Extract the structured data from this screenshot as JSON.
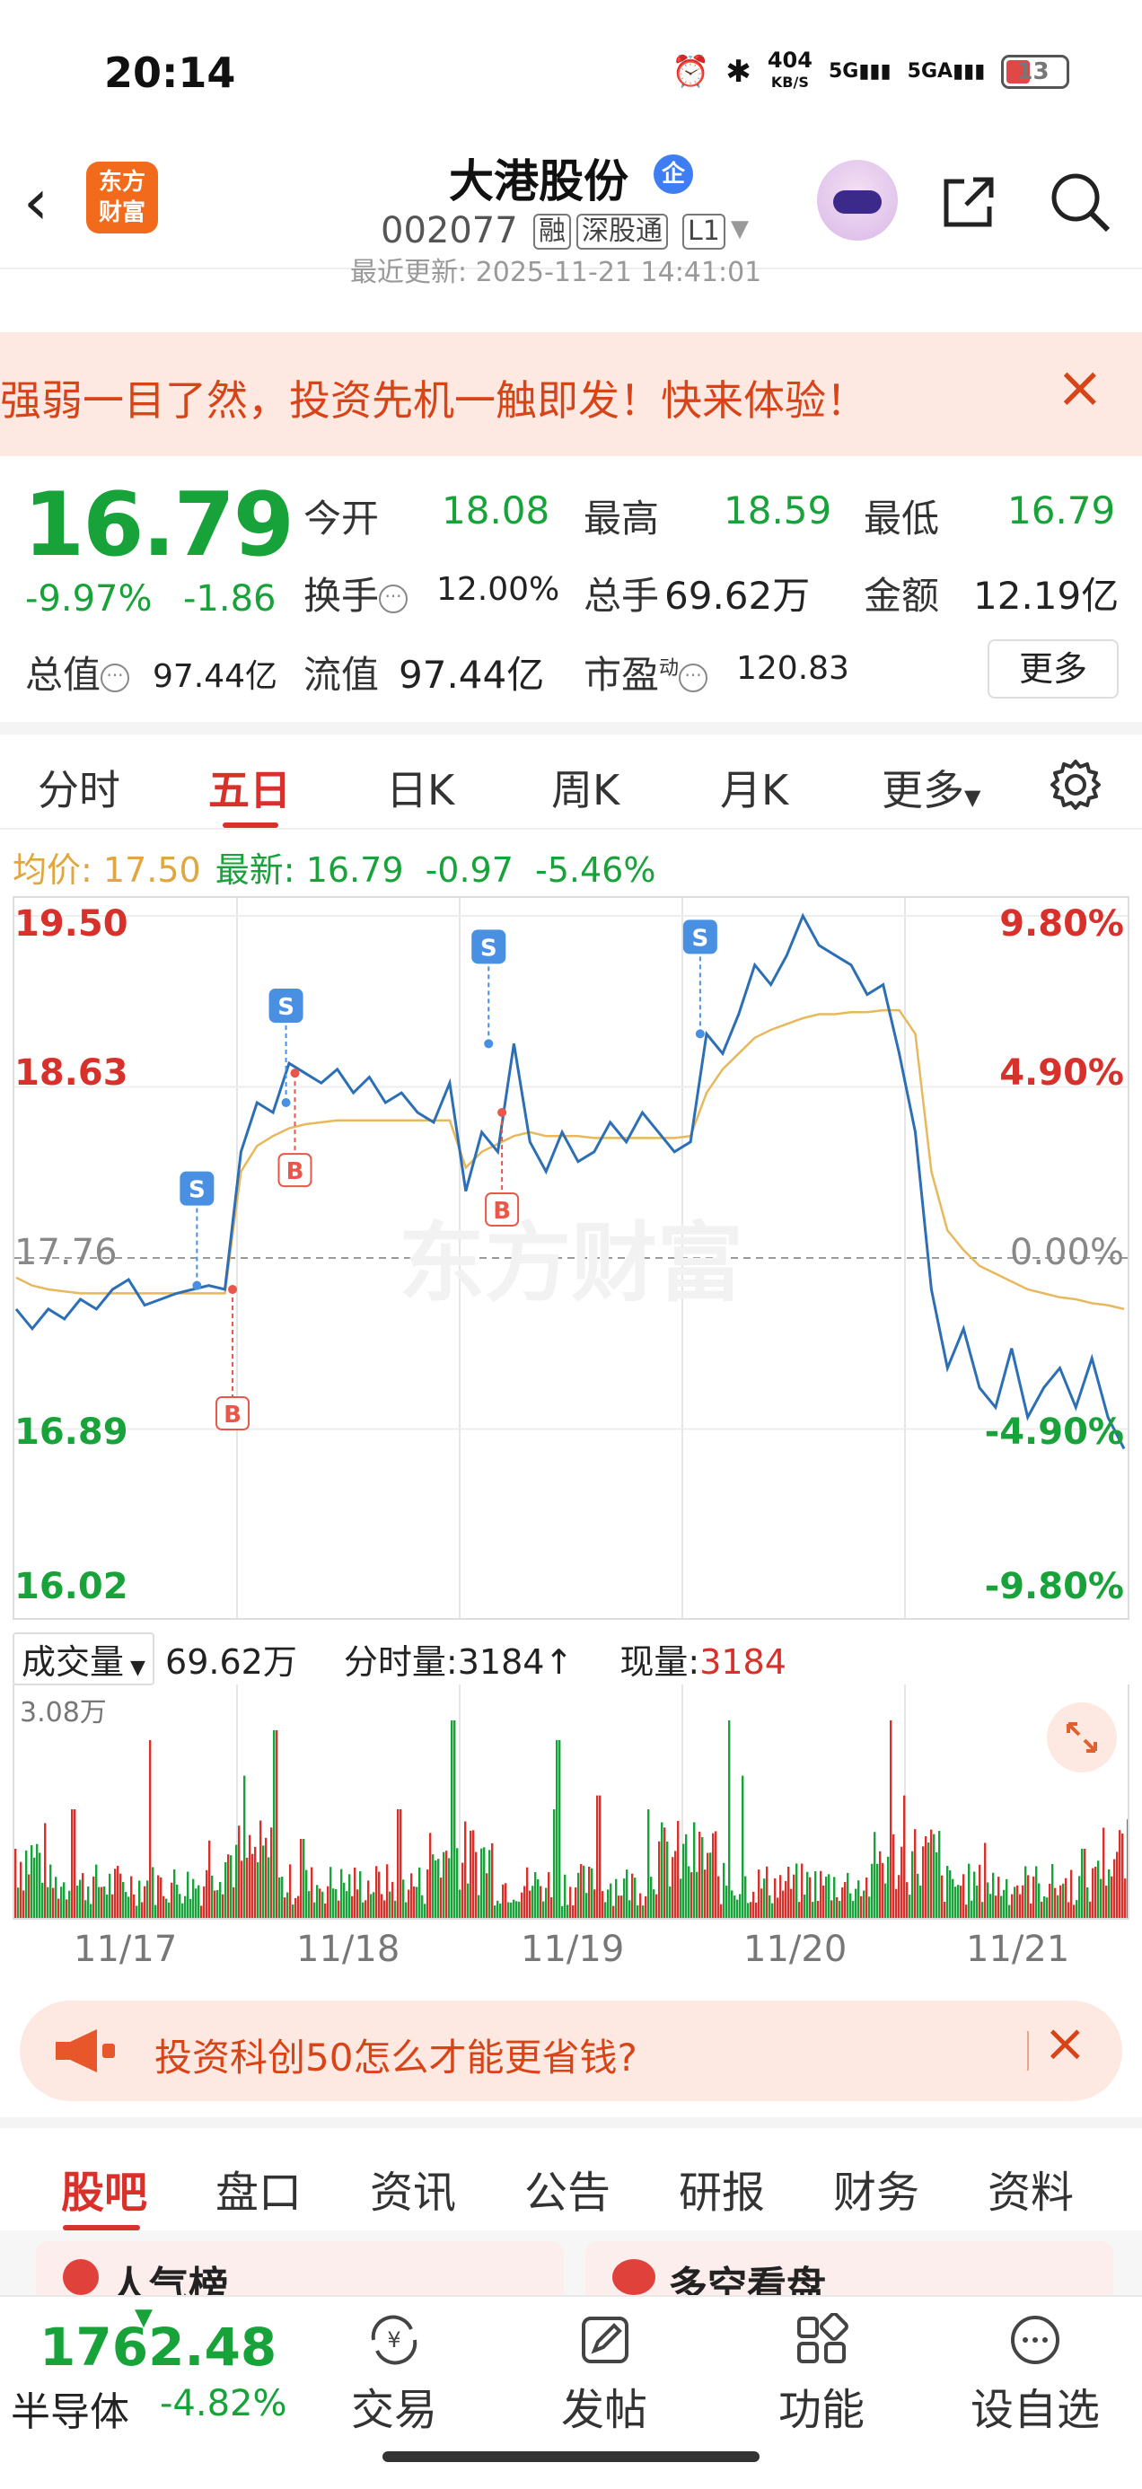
{
  "status_bar": {
    "time": "20:14",
    "net_speed_top": "404",
    "net_speed_unit": "KB/S",
    "signal_1": "5G",
    "signal_2": "5GA",
    "battery": "13"
  },
  "header": {
    "logo_line1": "东方",
    "logo_line2": "财富",
    "stock_name": "大港股份",
    "verified_badge": "企",
    "stock_code": "002077",
    "tags": [
      "融",
      "深股通",
      "L1"
    ],
    "last_update": "最近更新: 2025-11-21 14:41:01"
  },
  "banner": {
    "text": "强弱一目了然，投资先机一触即发！快来体验！"
  },
  "quote": {
    "price": "16.79",
    "pct_change": "-9.97%",
    "abs_change": "-1.86",
    "open_label": "今开",
    "open_value": "18.08",
    "high_label": "最高",
    "high_value": "18.59",
    "low_label": "最低",
    "low_value": "16.79",
    "turnover_label": "换手",
    "turnover_value": "12.00%",
    "volume_label": "总手",
    "volume_value": "69.62万",
    "amount_label": "金额",
    "amount_value": "12.19亿",
    "mcap_label": "总值",
    "mcap_value": "97.44亿",
    "float_label": "流值",
    "float_value": "97.44亿",
    "pe_label": "市盈",
    "pe_sup": "动",
    "pe_value": "120.83",
    "more_button": "更多"
  },
  "chart_tabs": [
    "分时",
    "五日",
    "日K",
    "周K",
    "月K",
    "更多"
  ],
  "active_chart_tab": "五日",
  "metrics": {
    "avg_label": "均价:",
    "avg_value": "17.50",
    "latest_label": "最新:",
    "latest_value": "16.79",
    "latest_change": "-0.97",
    "latest_pct": "-5.46%"
  },
  "chart_data": {
    "type": "line",
    "title": "",
    "x": [
      "11/17",
      "11/18",
      "11/19",
      "11/20",
      "11/21"
    ],
    "y_left_ticks": [
      "19.50",
      "18.63",
      "17.76",
      "16.89",
      "16.02"
    ],
    "y_right_ticks": [
      "9.80%",
      "4.90%",
      "0.00%",
      "-4.90%",
      "-9.80%"
    ],
    "ylim": [
      16.02,
      19.5
    ],
    "reference_price": 17.76,
    "series": [
      {
        "name": "最新",
        "color": "#2d6fb5",
        "values": [
          17.5,
          17.4,
          17.5,
          17.45,
          17.55,
          17.5,
          17.6,
          17.65,
          17.52,
          17.55,
          17.58,
          17.6,
          17.62,
          17.6,
          18.3,
          18.55,
          18.5,
          18.75,
          18.7,
          18.65,
          18.72,
          18.6,
          18.68,
          18.55,
          18.6,
          18.5,
          18.45,
          18.65,
          18.1,
          18.4,
          18.3,
          18.85,
          18.35,
          18.2,
          18.4,
          18.25,
          18.3,
          18.45,
          18.35,
          18.5,
          18.4,
          18.3,
          18.35,
          18.9,
          18.8,
          19.0,
          19.25,
          19.15,
          19.3,
          19.5,
          19.35,
          19.3,
          19.25,
          19.1,
          19.15,
          18.8,
          18.4,
          17.6,
          17.2,
          17.4,
          17.1,
          17.0,
          17.3,
          16.95,
          17.1,
          17.2,
          17.0,
          17.25,
          16.95,
          16.79
        ]
      },
      {
        "name": "均价",
        "color": "#e8b85c",
        "values": [
          17.66,
          17.62,
          17.6,
          17.59,
          17.58,
          17.58,
          17.58,
          17.58,
          17.58,
          17.58,
          17.58,
          17.58,
          17.58,
          17.58,
          18.2,
          18.33,
          18.38,
          18.42,
          18.44,
          18.45,
          18.46,
          18.46,
          18.46,
          18.46,
          18.46,
          18.46,
          18.46,
          18.46,
          18.22,
          18.3,
          18.34,
          18.38,
          18.4,
          18.38,
          18.38,
          18.38,
          18.37,
          18.37,
          18.37,
          18.37,
          18.37,
          18.37,
          18.38,
          18.6,
          18.72,
          18.8,
          18.88,
          18.92,
          18.95,
          18.98,
          19.0,
          19.0,
          19.01,
          19.01,
          19.02,
          19.02,
          18.9,
          18.2,
          17.9,
          17.8,
          17.72,
          17.68,
          17.64,
          17.6,
          17.58,
          17.56,
          17.55,
          17.53,
          17.52,
          17.5
        ]
      }
    ],
    "markers": [
      {
        "day": "11/17",
        "type": "S",
        "price": 17.62
      },
      {
        "day": "11/17",
        "type": "B",
        "price": 17.6
      },
      {
        "day": "11/18",
        "type": "S",
        "price": 18.55
      },
      {
        "day": "11/18",
        "type": "B",
        "price": 18.7
      },
      {
        "day": "11/19",
        "type": "S",
        "price": 18.85
      },
      {
        "day": "11/19",
        "type": "B",
        "price": 18.5
      },
      {
        "day": "11/20",
        "type": "S",
        "price": 18.9
      }
    ],
    "watermark": "东方财富"
  },
  "volume": {
    "selector_label": "成交量",
    "total": "69.62万",
    "minute_label": "分时量:",
    "minute_value": "3184",
    "minute_arrow": "↑",
    "current_label": "现量:",
    "current_value": "3184",
    "max_label": "3.08万"
  },
  "dates": [
    "11/17",
    "11/18",
    "11/19",
    "11/20",
    "11/21"
  ],
  "ad": {
    "text": "投资科创50怎么才能更省钱?"
  },
  "sub_tabs": [
    "股吧",
    "盘口",
    "资讯",
    "公告",
    "研报",
    "财务",
    "资料"
  ],
  "active_sub_tab": "股吧",
  "cards_peek": [
    "人气榜",
    "多空看盘"
  ],
  "bottom_bar": {
    "index_value": "1762.48",
    "index_name": "半导体",
    "index_pct": "-4.82%",
    "nav": [
      "交易",
      "发帖",
      "功能",
      "设自选"
    ]
  },
  "colors": {
    "up": "#d8302b",
    "down": "#18a23a",
    "accent": "#f26a1b",
    "price_line": "#2d6fb5",
    "avg_line": "#e8b85c"
  }
}
